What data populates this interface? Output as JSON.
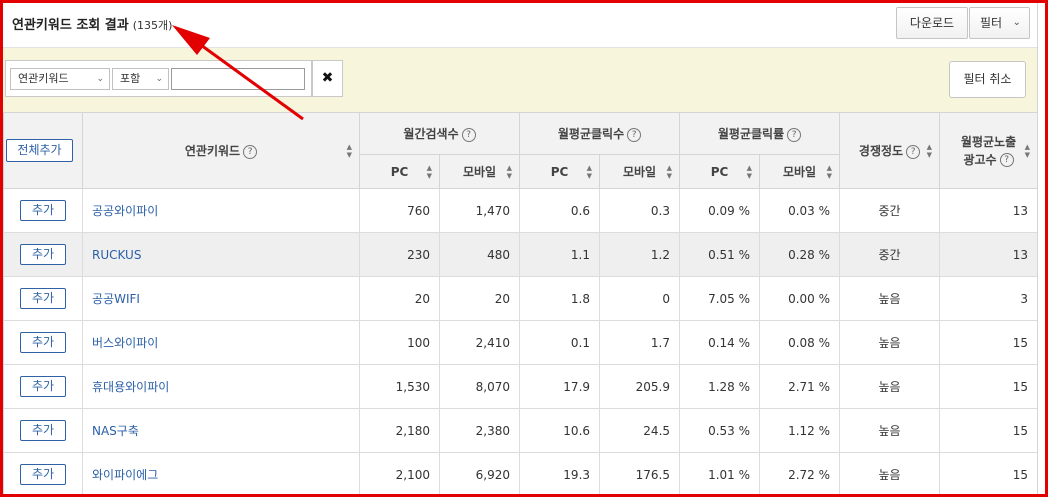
{
  "header": {
    "title": "연관키워드 조회 결과",
    "count": "(135개)",
    "download_label": "다운로드",
    "filter_label": "필터"
  },
  "filter_bar": {
    "keyword_select": "연관키워드",
    "match_select": "포함",
    "input_value": "",
    "clear_icon": "✖",
    "cancel_label": "필터 취소"
  },
  "table": {
    "add_all_label": "전체추가",
    "headers": {
      "keyword": "연관키워드",
      "monthly_search": "월간검색수",
      "avg_clicks": "월평균클릭수",
      "avg_ctr": "월평균클릭률",
      "competition": "경쟁정도",
      "avg_ads_line1": "월평균노출",
      "avg_ads_line2": "광고수",
      "pc": "PC",
      "mobile": "모바일"
    },
    "add_label": "추가",
    "rows": [
      {
        "keyword": "공공와이파이",
        "search_pc": "760",
        "search_mobile": "1,470",
        "click_pc": "0.6",
        "click_mobile": "0.3",
        "ctr_pc": "0.09 %",
        "ctr_mobile": "0.03 %",
        "competition": "중간",
        "ads": "13"
      },
      {
        "keyword": "RUCKUS",
        "search_pc": "230",
        "search_mobile": "480",
        "click_pc": "1.1",
        "click_mobile": "1.2",
        "ctr_pc": "0.51 %",
        "ctr_mobile": "0.28 %",
        "competition": "중간",
        "ads": "13"
      },
      {
        "keyword": "공공WIFI",
        "search_pc": "20",
        "search_mobile": "20",
        "click_pc": "1.8",
        "click_mobile": "0",
        "ctr_pc": "7.05 %",
        "ctr_mobile": "0.00 %",
        "competition": "높음",
        "ads": "3"
      },
      {
        "keyword": "버스와이파이",
        "search_pc": "100",
        "search_mobile": "2,410",
        "click_pc": "0.1",
        "click_mobile": "1.7",
        "ctr_pc": "0.14 %",
        "ctr_mobile": "0.08 %",
        "competition": "높음",
        "ads": "15"
      },
      {
        "keyword": "휴대용와이파이",
        "search_pc": "1,530",
        "search_mobile": "8,070",
        "click_pc": "17.9",
        "click_mobile": "205.9",
        "ctr_pc": "1.28 %",
        "ctr_mobile": "2.71 %",
        "competition": "높음",
        "ads": "15"
      },
      {
        "keyword": "NAS구축",
        "search_pc": "2,180",
        "search_mobile": "2,380",
        "click_pc": "10.6",
        "click_mobile": "24.5",
        "ctr_pc": "0.53 %",
        "ctr_mobile": "1.12 %",
        "competition": "높음",
        "ads": "15"
      },
      {
        "keyword": "와이파이에그",
        "search_pc": "2,100",
        "search_mobile": "6,920",
        "click_pc": "19.3",
        "click_mobile": "176.5",
        "ctr_pc": "1.01 %",
        "ctr_mobile": "2.72 %",
        "competition": "높음",
        "ads": "15"
      }
    ]
  },
  "colors": {
    "frame_border": "#e30000",
    "annotation_arrow": "#e30000",
    "link_blue": "#2a5fa8",
    "filter_bar_bg": "#f7f6dd",
    "header_bg": "#f2f2f2"
  },
  "icons": {
    "help": "question-circle-icon",
    "sort": "sort-toggle-icon",
    "dropdown": "chevron-down-icon",
    "clear": "close-x-icon"
  }
}
